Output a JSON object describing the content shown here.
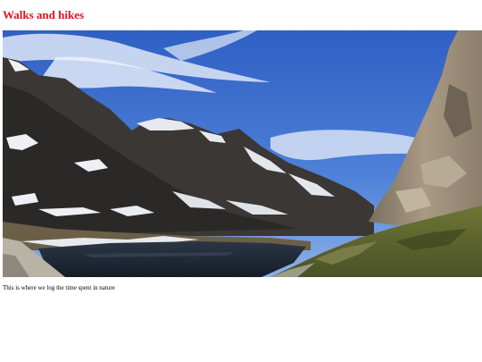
{
  "page": {
    "title": "Walks and hikes",
    "caption": "This is where we log the time spent in nature"
  },
  "hero_image": {
    "subject": "mountain-lake-landscape",
    "colors": {
      "title_red": "#e8111b",
      "sky_top": "#2f5fc4",
      "sky_bottom": "#6b98df",
      "lake": "#1f2a3a",
      "rock": "#3f3c39",
      "snow": "#f2f3f5",
      "cliff": "#9a8d78",
      "grass": "#5f6a2e"
    }
  }
}
